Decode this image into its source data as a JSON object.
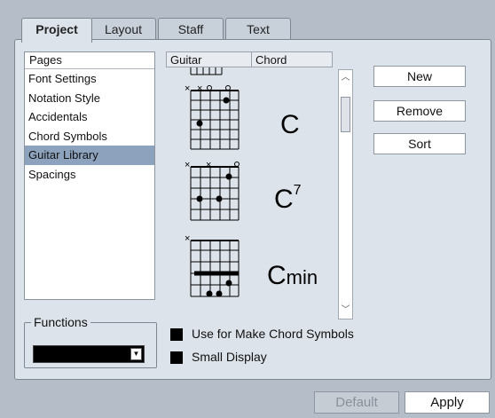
{
  "tabs": [
    {
      "label": "Project",
      "active": true
    },
    {
      "label": "Layout",
      "active": false
    },
    {
      "label": "Staff",
      "active": false
    },
    {
      "label": "Text",
      "active": false
    }
  ],
  "pages": {
    "header": "Pages",
    "items": [
      "Font Settings",
      "Notation Style",
      "Accidentals",
      "Chord Symbols",
      "Guitar Library",
      "Spacings"
    ],
    "selected": "Guitar Library"
  },
  "library": {
    "columns": [
      "Guitar",
      "Chord"
    ],
    "chords": [
      {
        "root": "C",
        "suffix_sup": "",
        "suffix": ""
      },
      {
        "root": "C",
        "suffix_sup": "7",
        "suffix": ""
      },
      {
        "root": "C",
        "suffix_sup": "",
        "suffix": "min"
      }
    ]
  },
  "buttons": {
    "new": "New",
    "remove": "Remove",
    "sort": "Sort"
  },
  "functions": {
    "legend": "Functions",
    "value": ""
  },
  "options": [
    {
      "label": "Use for Make Chord Symbols",
      "checked": false
    },
    {
      "label": "Small Display",
      "checked": false
    }
  ],
  "footer": {
    "default": "Default",
    "apply": "Apply"
  },
  "colors": {
    "background": "#b5bdc8",
    "panel": "#dde3ea",
    "selection": "#8ca2bd"
  }
}
